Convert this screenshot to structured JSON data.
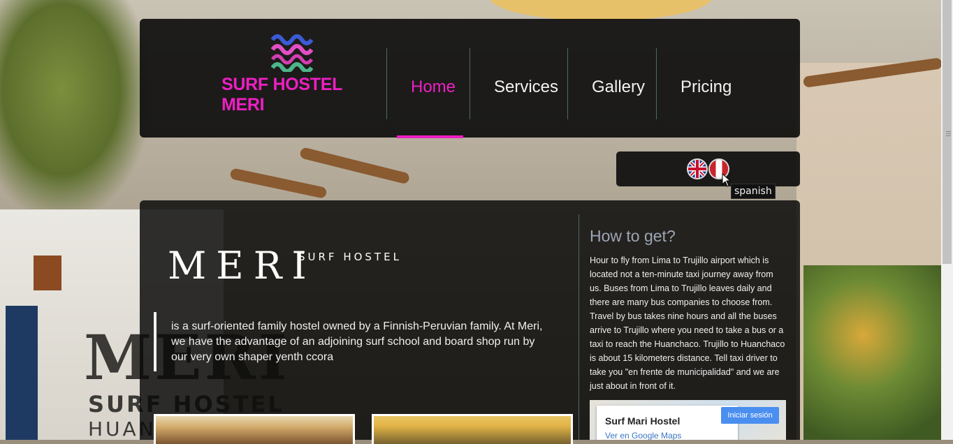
{
  "brand": {
    "name": "SURF HOSTEL MERI"
  },
  "nav": {
    "items": [
      {
        "label": "Home",
        "active": true
      },
      {
        "label": "Services",
        "active": false
      },
      {
        "label": "Gallery",
        "active": false
      },
      {
        "label": "Pricing",
        "active": false
      }
    ]
  },
  "language": {
    "flags": [
      {
        "icon": "uk-flag-icon"
      },
      {
        "icon": "peru-flag-icon"
      }
    ],
    "tooltip": "spanish"
  },
  "hero": {
    "title": "MERI",
    "subtitle": "SURF HOSTEL",
    "quote": "is a surf-oriented family hostel owned by a Finnish-Peruvian family. At Meri, we have the advantage of an adjoining surf school and board shop run by our very own shaper yenth ccora"
  },
  "sidebar": {
    "title": "How to get?",
    "text": "Hour to fly from Lima to Trujillo airport which is located not a ten-minute taxi journey away from us. Buses from Lima to Trujillo leaves daily and there are many bus companies to choose from. Travel by bus takes nine hours and all the buses arrive to Trujillo where you need to take a bus or a taxi to reach the Huanchaco. Trujillo to Huanchaco is about 15 kilometers distance. Tell taxi driver to take you \"en frente de municipalidad\" and we are just about in front of it."
  },
  "map": {
    "place": "Surf Mari Hostel",
    "link": "Ver en Google Maps",
    "signin": "Iniciar sesión"
  },
  "background": {
    "sign_main": "MERI",
    "sign_surf": "SURF HOSTEL",
    "sign_town": "HUAN"
  },
  "colors": {
    "accent": "#ee1fc3",
    "panel": "#0a0a0a"
  }
}
